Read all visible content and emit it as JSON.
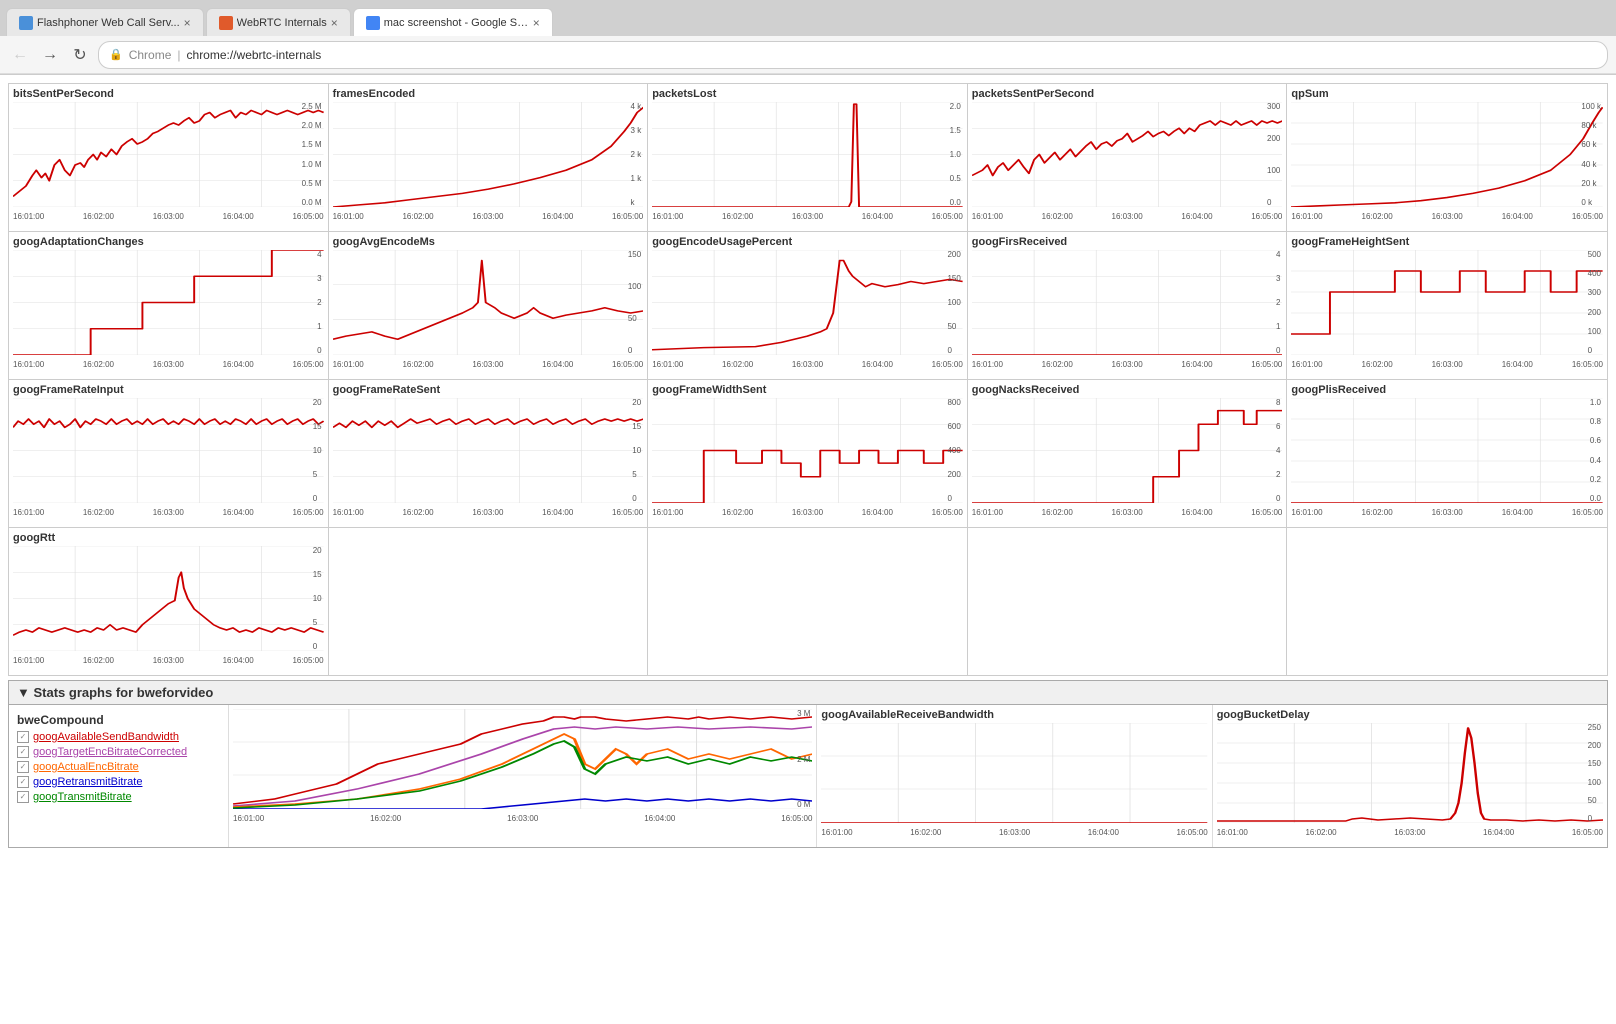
{
  "browser": {
    "tabs": [
      {
        "id": "tab1",
        "label": "Flashphoner Web Call Serv...",
        "active": false,
        "favicon_color": "#4a90d9"
      },
      {
        "id": "tab2",
        "label": "WebRTC Internals",
        "active": false,
        "favicon_color": "#e05a2b"
      },
      {
        "id": "tab3",
        "label": "mac screenshot - Google Sea...",
        "active": true,
        "favicon_color": "#4285f4"
      }
    ],
    "url_chrome": "Chrome",
    "url": "chrome://webrtc-internals"
  },
  "nav": {
    "back": "←",
    "forward": "→",
    "refresh": "↻"
  },
  "sections": {
    "stats_title": "▼ Stats graphs for bweforvideo"
  },
  "charts_row1": [
    {
      "id": "bitsSentPerSecond",
      "title": "bitsSentPerSecond",
      "ymax": "2.5 M",
      "ymid2": "2.0 M",
      "ymid": "1.5 M",
      "ymid3": "1.0 M",
      "ylow": "0.5 M",
      "ymin": "0.0 M"
    },
    {
      "id": "framesEncoded",
      "title": "framesEncoded",
      "ymax": "4 k",
      "ymid": "3 k",
      "ymid2": "2 k",
      "ymid3": "1 k",
      "ymin": "k"
    },
    {
      "id": "packetsLost",
      "title": "packetsLost",
      "ymax": "2.0",
      "ymid": "1.5",
      "ymid2": "1.0",
      "ymid3": "0.5",
      "ymin": "0.0"
    },
    {
      "id": "packetsSentPerSecond",
      "title": "packetsSentPerSecond",
      "ymax": "300",
      "ymid": "200",
      "ymid2": "100",
      "ymin": "0"
    },
    {
      "id": "qpSum",
      "title": "qpSum",
      "ymax": "100 k",
      "ymid": "80 k",
      "ymid2": "60 k",
      "ymid3": "40 k",
      "ymid4": "20 k",
      "ymin": "0 k"
    }
  ],
  "charts_row2": [
    {
      "id": "googAdaptationChanges",
      "title": "googAdaptationChanges",
      "ymax": "4",
      "ymid": "3",
      "ymid2": "2",
      "ymid3": "1",
      "ymin": "0"
    },
    {
      "id": "googAvgEncodeMs",
      "title": "googAvgEncodeMs",
      "ymax": "150",
      "ymid": "100",
      "ymid2": "50",
      "ymin": "0"
    },
    {
      "id": "googEncodeUsagePercent",
      "title": "googEncodeUsagePercent",
      "ymax": "200",
      "ymid": "150",
      "ymid2": "100",
      "ymid3": "50",
      "ymin": "0"
    },
    {
      "id": "googFirsReceived",
      "title": "googFirsReceived",
      "ymax": "4",
      "ymid": "3",
      "ymid2": "2",
      "ymid3": "1",
      "ymin": "0"
    },
    {
      "id": "googFrameHeightSent",
      "title": "googFrameHeightSent",
      "ymax": "500",
      "ymid": "400",
      "ymid2": "300",
      "ymid3": "200",
      "ymid4": "100",
      "ymin": "0"
    }
  ],
  "charts_row3": [
    {
      "id": "googFrameRateInput",
      "title": "googFrameRateInput",
      "ymax": "20",
      "ymid": "15",
      "ymid2": "10",
      "ymid3": "5",
      "ymin": "0"
    },
    {
      "id": "googFrameRateSent",
      "title": "googFrameRateSent",
      "ymax": "20",
      "ymid": "15",
      "ymid2": "10",
      "ymid3": "5",
      "ymin": "0"
    },
    {
      "id": "googFrameWidthSent",
      "title": "googFrameWidthSent",
      "ymax": "800",
      "ymid": "600",
      "ymid2": "400",
      "ymid3": "200",
      "ymin": "0"
    },
    {
      "id": "googNacksReceived",
      "title": "googNacksReceived",
      "ymax": "8",
      "ymid": "6",
      "ymid2": "4",
      "ymid3": "2",
      "ymin": "0"
    },
    {
      "id": "googPlisReceived",
      "title": "googPlisReceived",
      "ymax": "1.0",
      "ymid": "0.8",
      "ymid2": "0.6",
      "ymid3": "0.4",
      "ymid4": "0.2",
      "ymin": "0.0"
    }
  ],
  "chart_rtt": {
    "id": "googRtt",
    "title": "googRtt",
    "ymax": "20",
    "ymid": "15",
    "ymid2": "10",
    "ymid3": "5",
    "ymin": "0"
  },
  "xaxis_labels": [
    "16:01:00",
    "16:02:00",
    "16:03:00",
    "16:04:00",
    "16:05:00"
  ],
  "bwe": {
    "header": "▼ Stats graphs for bweforvideo",
    "compound_title": "bweCompound",
    "legend": [
      {
        "label": "googAvailableSendBandwidth",
        "color": "#cc0000",
        "checked": true
      },
      {
        "label": "googTargetEncBitrateCorrected",
        "color": "#aa44aa",
        "checked": true
      },
      {
        "label": "googActualEncBitrate",
        "color": "#ff6600",
        "checked": true
      },
      {
        "label": "googRetransmitBitrate",
        "color": "#0000cc",
        "checked": true
      },
      {
        "label": "googTransmitBitrate",
        "color": "#008800",
        "checked": true
      }
    ],
    "compound_ymax": "3 M",
    "compound_ymid": "2 M",
    "compound_ymin": "0 M",
    "available_receive_title": "googAvailableReceiveBandwidth",
    "bucket_delay_title": "googBucketDelay",
    "bucket_ymax": "250",
    "bucket_ymid4": "200",
    "bucket_ymid3": "150",
    "bucket_ymid2": "100",
    "bucket_ymid": "50",
    "bucket_ymin": "0"
  }
}
